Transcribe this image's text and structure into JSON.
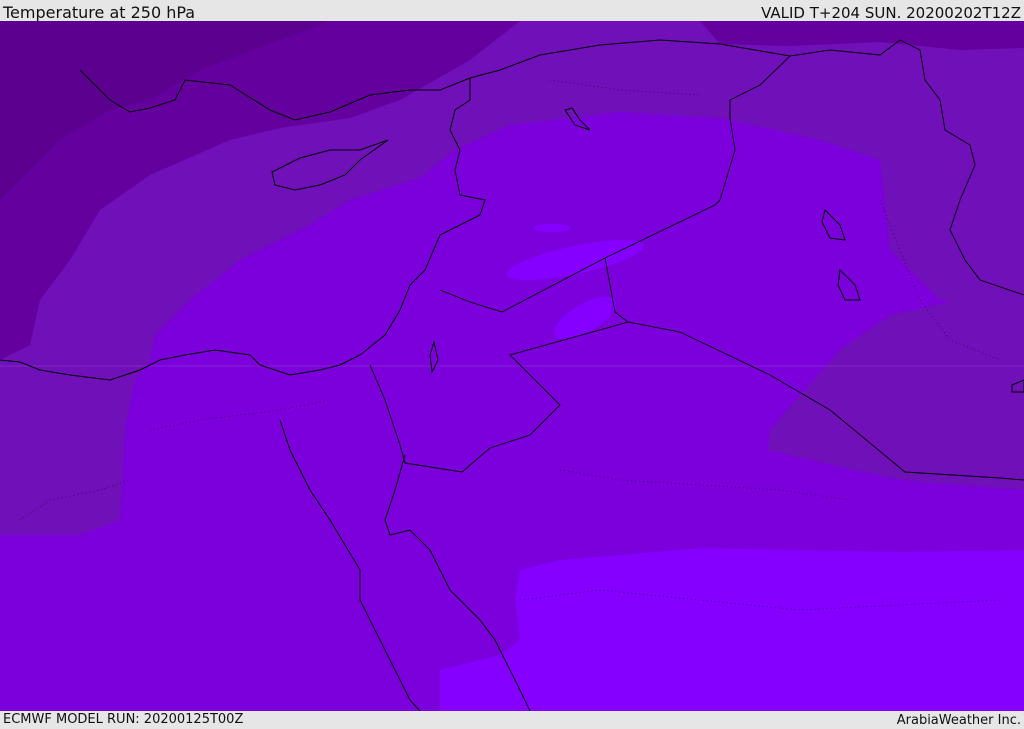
{
  "header": {
    "title": "Temperature at 250 hPa",
    "valid": "VALID T+204 SUN. 20200202T12Z"
  },
  "footer": {
    "model_run": "ECMWF MODEL RUN: 20200125T00Z",
    "credit": "ArabiaWeather Inc."
  },
  "colors": {
    "band_darkest": "#5c008f",
    "band_dark": "#64009e",
    "band_mid": "#7010b8",
    "band_main": "#7b00db",
    "band_light": "#8500ff",
    "band_bright": "#7c1aff",
    "coastline": "#000000",
    "header_bg": "#e6e6e6"
  }
}
